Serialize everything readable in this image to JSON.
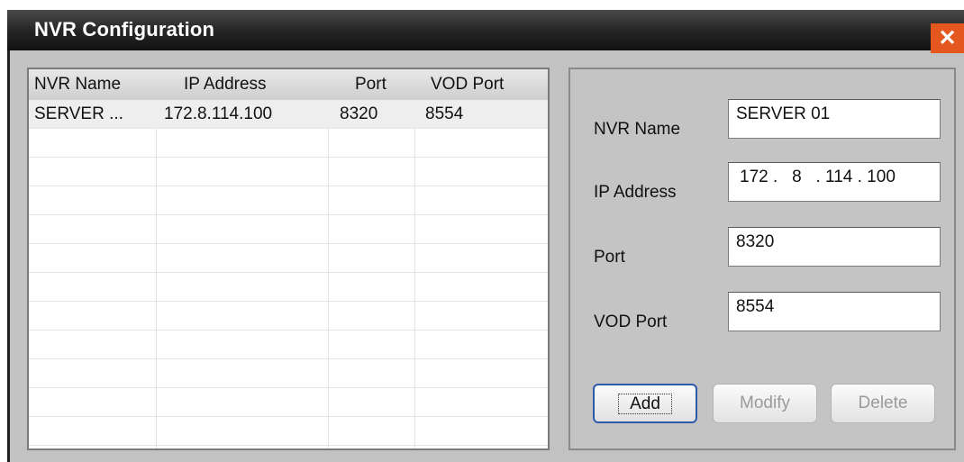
{
  "window": {
    "title": "NVR Configuration",
    "close_glyph": "✕"
  },
  "list": {
    "columns": [
      "NVR Name",
      "IP Address",
      "Port",
      "VOD Port"
    ],
    "rows": [
      [
        "SERVER ...",
        "172.8.114.100",
        "8320",
        "8554"
      ]
    ]
  },
  "form": {
    "name_label": "NVR Name",
    "name_value": "SERVER 01",
    "ip_label": "IP Address",
    "ip_value": "172 .   8   . 114 . 100",
    "port_label": "Port",
    "port_value": "8320",
    "vod_label": "VOD Port",
    "vod_value": "8554"
  },
  "buttons": {
    "add": "Add",
    "modify": "Modify",
    "delete": "Delete"
  },
  "colors": {
    "close_bg": "#e4571e",
    "focus_border": "#2b5aa8"
  }
}
